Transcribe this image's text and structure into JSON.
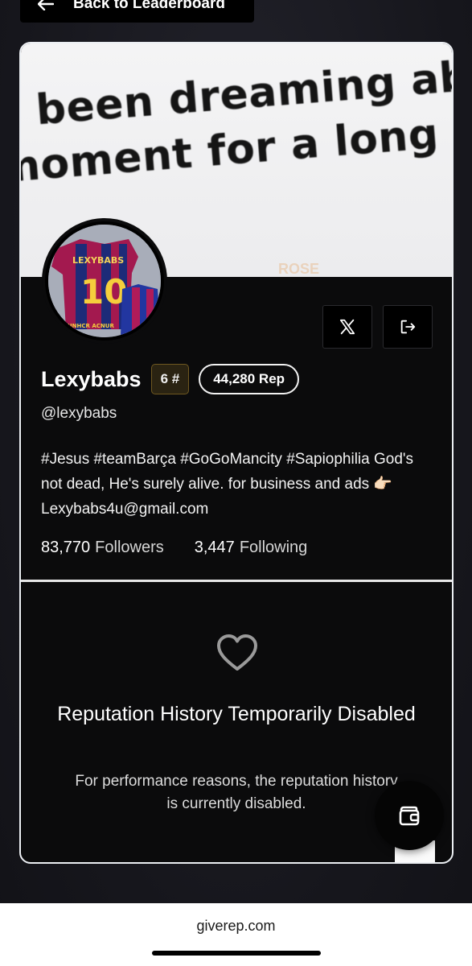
{
  "nav": {
    "back_label": "Back to Leaderboard"
  },
  "banner": {
    "line1": "e been dreaming ab",
    "line2": "moment for a long",
    "faint_text": "ROSE"
  },
  "avatar": {
    "jersey_text": "LEXYBABS",
    "jersey_number": "10",
    "sponsor": "UNHCR ACNUR"
  },
  "profile": {
    "name": "Lexybabs",
    "rank": "6 #",
    "rep": "44,280 Rep",
    "handle": "@lexybabs",
    "bio": "#Jesus #teamBarça #GoGoMancity #Sapiophilia God's not dead, He's surely alive. for business and ads 👉🏻 Lexybabs4u@gmail.com",
    "followers_count": "83,770",
    "followers_label": "Followers",
    "following_count": "3,447",
    "following_label": "Following"
  },
  "actions": {
    "x_icon": "x-logo-icon",
    "share_icon": "logout-share-icon"
  },
  "reputation": {
    "title": "Reputation History Temporarily Disabled",
    "description": "For performance reasons, the reputation history is currently disabled."
  },
  "fab": {
    "icon": "wallet-icon"
  },
  "browser": {
    "url": "giverep.com"
  },
  "colors": {
    "background": "#17171e",
    "card": "#0b0b0c",
    "rank_badge_bg": "#2a2312",
    "rank_badge_border": "#6f5820"
  }
}
